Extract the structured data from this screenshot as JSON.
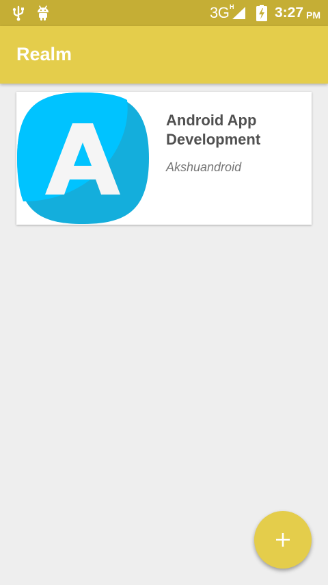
{
  "status_bar": {
    "network": "3G",
    "network_sub": "H",
    "time": "3:27",
    "ampm": "PM",
    "icons": [
      "usb-icon",
      "android-icon",
      "signal-icon",
      "battery-charging-icon"
    ]
  },
  "app_bar": {
    "title": "Realm"
  },
  "cards": [
    {
      "title": "Android App Development",
      "subtitle": "Akshuandroid",
      "thumbnail_letter": "A",
      "thumbnail_icon": "app-logo-icon"
    }
  ],
  "fab": {
    "icon": "plus-icon"
  },
  "colors": {
    "status_bar": "#C5AE35",
    "app_bar": "#E4CD4B",
    "accent": "#E4CD4B",
    "background": "#EEEEEE",
    "logo_light": "#00C3FF",
    "logo_dark": "#14AEDC"
  }
}
